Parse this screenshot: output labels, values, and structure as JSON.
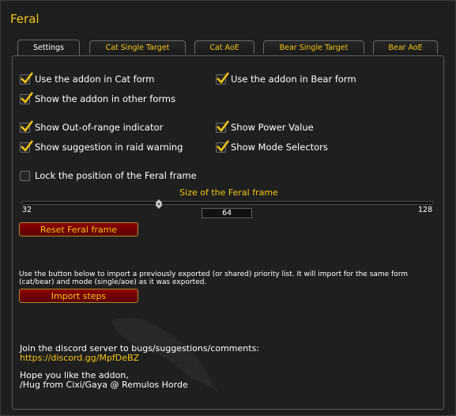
{
  "window": {
    "title": "Feral"
  },
  "tabs": [
    {
      "label": "Settings"
    },
    {
      "label": "Cat Single Target"
    },
    {
      "label": "Cat AoE"
    },
    {
      "label": "Bear Single Target"
    },
    {
      "label": "Bear AoE"
    }
  ],
  "options": {
    "cat_form": {
      "label": "Use the addon in Cat form",
      "checked": true
    },
    "bear_form": {
      "label": "Use the addon in Bear form",
      "checked": true
    },
    "other_forms": {
      "label": "Show the addon in other forms",
      "checked": true
    },
    "out_of_range": {
      "label": "Show Out-of-range indicator",
      "checked": true
    },
    "power_value": {
      "label": "Show Power Value",
      "checked": true
    },
    "raid_warning": {
      "label": "Show suggestion in raid warning",
      "checked": true
    },
    "mode_selectors": {
      "label": "Show Mode Selectors",
      "checked": true
    },
    "lock_position": {
      "label": "Lock the position of the Feral frame",
      "checked": false
    }
  },
  "size_slider": {
    "label": "Size of the Feral frame",
    "min": "32",
    "max": "128",
    "value": "64",
    "value_num": 64
  },
  "buttons": {
    "reset": "Reset Feral frame",
    "import": "Import steps"
  },
  "import_info": "Use the button below to import a previously exported (or shared) priority list. It will import for the same form (cat/bear) and mode (single/aoe) as it was exported.",
  "footer": {
    "discord_text": "Join the discord server to bugs/suggestions/comments:",
    "discord_link": "https://discord.gg/MpfDeBZ",
    "hope_text": "Hope you like the addon,",
    "hug_text": "/Hug from Cixi/Gaya @ Remulos Horde"
  },
  "colors": {
    "accent_gold": "#f5c518",
    "button_red": "#7a0000",
    "text_white": "#ffffff"
  }
}
